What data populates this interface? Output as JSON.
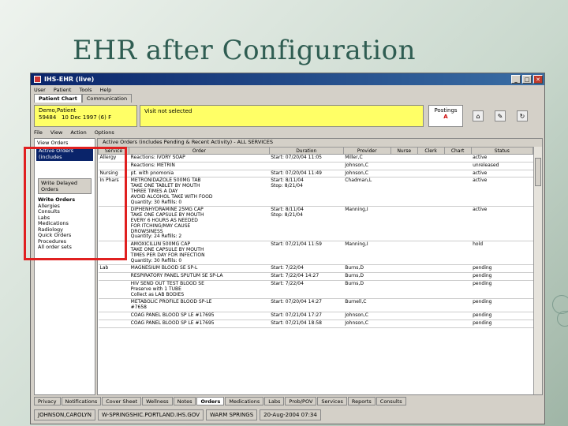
{
  "slide": {
    "title": "EHR after Configuration"
  },
  "window": {
    "title": "IHS-EHR (live)",
    "menu": [
      "User",
      "Patient",
      "Tools",
      "Help"
    ],
    "top_tabs": [
      "Patient Chart",
      "Communication"
    ]
  },
  "patient": {
    "name": "Demo,Patient",
    "id": "59484",
    "dob": "10 Dec 1997",
    "age": "(6)",
    "sex": "F",
    "visit": "Visit not selected",
    "postings_label": "Postings",
    "postings_alert": "A"
  },
  "submenu": [
    "File",
    "View",
    "Action",
    "Options"
  ],
  "left_panel": {
    "title": "View Orders",
    "active_selection": "Active Orders (includes",
    "button": "Write Delayed Orders",
    "write_orders_head": "Write Orders",
    "items": [
      "Allergies",
      "Consults",
      "Labs",
      "Medications",
      "Radiology",
      "Quick Orders",
      "Procedures",
      "All order sets"
    ]
  },
  "grid": {
    "filter": "Active Orders (includes Pending & Recent Activity) - ALL SERVICES",
    "columns": [
      "Service",
      "Order",
      "Duration",
      "Provider",
      "Nurse",
      "Clerk",
      "Chart",
      "Status"
    ],
    "rows": [
      {
        "service": "Allergy",
        "order": "Reactions: IVORY SOAP",
        "duration": "Start: 07/20/04 11:05",
        "provider": "Miller,C",
        "status": "active"
      },
      {
        "service": "",
        "order": "Reactions: METRIN",
        "duration": "",
        "provider": "Johnson,C",
        "status": "unreleased"
      },
      {
        "service": "Nursing",
        "order": "pt. with pnomonia",
        "duration": "Start: 07/20/04 11:49",
        "provider": "Johnson,C",
        "status": "active"
      },
      {
        "service": "In Phars",
        "order": "METRONIDAZOLE 500MG TAB\nTAKE ONE TABLET BY MOUTH\nTHREE TIMES A DAY\nAVOID ALCOHOL TAKE WITH FOOD\nQuantity: 30 Refills: 0",
        "duration": "Start: 8/11/04\nStop: 8/21/04",
        "provider": "Chadman,L",
        "status": "active"
      },
      {
        "service": "",
        "order": "DIPHENHYDRAMINE 25MG CAP\nTAKE ONE CAPSULE BY MOUTH\nEVERY 6 HOURS AS NEEDED\nFOR ITCHING/MAY CAUSE\nDROWSINESS\nQuantity: 24 Refills: 2",
        "duration": "Start: 8/11/04\nStop: 8/21/04",
        "provider": "Manning,I",
        "status": "active"
      },
      {
        "service": "",
        "order": "AMOXICILLIN 500MG CAP\nTAKE ONE CAPSULE BY MOUTH\nTIMES PER DAY FOR INFECTION\nQuantity: 30 Refills: 0",
        "duration": "Start: 07/21/04 11:59",
        "provider": "Manning,I",
        "status": "hold"
      },
      {
        "service": "Lab",
        "order": "MAGNESIUM BLOOD SE SP-L",
        "duration": "Start: 7/22/04",
        "provider": "Burns,D",
        "status": "pending"
      },
      {
        "service": "",
        "order": "RESPIRATORY PANEL SPUTUM SE SP-LA",
        "duration": "Start: 7/22/04 14:27",
        "provider": "Burns,D",
        "status": "pending"
      },
      {
        "service": "",
        "order": "HIV SEND OUT TEST BLOOD SE\nPreserve with 1 TUBE\nCollect as LAB BODIES",
        "duration": "Start: 7/22/04",
        "provider": "Burns,D",
        "status": "pending"
      },
      {
        "service": "",
        "order": "METABOLIC PROFILE BLOOD SP-LE\n#7658",
        "duration": "Start: 07/20/04 14:27",
        "provider": "Burnell,C",
        "status": "pending"
      },
      {
        "service": "",
        "order": "COAG PANEL BLOOD SP LE #17695",
        "duration": "Start: 07/21/04 17:27",
        "provider": "Johnson,C",
        "status": "pending"
      },
      {
        "service": "",
        "order": "COAG PANEL BLOOD SP LE #17695",
        "duration": "Start: 07/21/04 18:58",
        "provider": "Johnson,C",
        "status": "pending"
      }
    ]
  },
  "bottom_tabs": [
    "Privacy",
    "Notifications",
    "Cover Sheet",
    "Wellness",
    "Notes",
    "Orders",
    "Medications",
    "Labs",
    "Prob/POV",
    "Services",
    "Reports",
    "Consults"
  ],
  "active_bottom_tab": "Orders",
  "status_bar": [
    "JOHNSON,CAROLYN",
    "W-SPRINGSHIC.PORTLAND.IHS.GOV",
    "WARM SPRINGS",
    "20-Aug-2004 07:34"
  ]
}
